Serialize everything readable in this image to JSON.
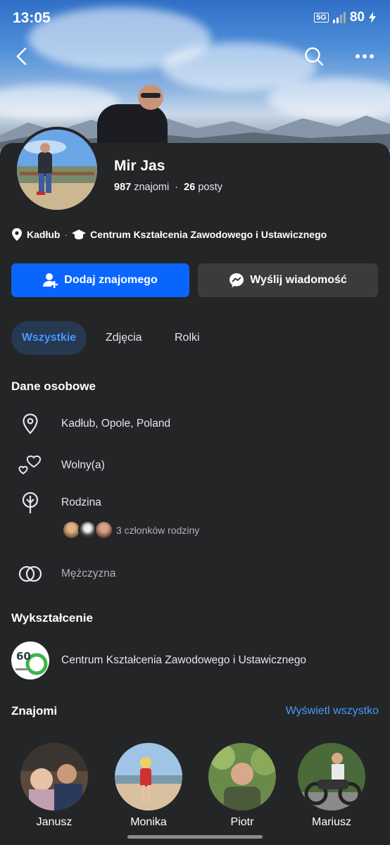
{
  "status_bar": {
    "time": "13:05",
    "network": "5G",
    "battery": "80"
  },
  "profile": {
    "name": "Mir Jas",
    "friends_count": "987",
    "friends_label": "znajomi",
    "separator": "·",
    "posts_count": "26",
    "posts_label": "posty",
    "location_short": "Kadłub",
    "school_short": "Centrum Kształcenia Zawodowego i Ustawicznego"
  },
  "actions": {
    "add_friend": "Dodaj znajomego",
    "send_message": "Wyślij wiadomość"
  },
  "tabs": [
    {
      "label": "Wszystkie",
      "active": true
    },
    {
      "label": "Zdjęcia",
      "active": false
    },
    {
      "label": "Rolki",
      "active": false
    }
  ],
  "personal": {
    "title": "Dane osobowe",
    "location": "Kadłub, Opole, Poland",
    "relationship": "Wolny(a)",
    "family_label": "Rodzina",
    "family_members": "3 członków rodziny",
    "gender": "Mężczyzna"
  },
  "education": {
    "title": "Wykształcenie",
    "school": "Centrum Kształcenia Zawodowego i Ustawicznego",
    "logo_text": "60"
  },
  "friends": {
    "title": "Znajomi",
    "see_all": "Wyświetl wszystko",
    "items": [
      {
        "name": "Janusz"
      },
      {
        "name": "Monika"
      },
      {
        "name": "Piotr"
      },
      {
        "name": "Mariusz"
      }
    ]
  },
  "colors": {
    "accent": "#0866ff",
    "link": "#4599ff",
    "background": "#242526",
    "secondary_button": "#3a3b3c"
  }
}
